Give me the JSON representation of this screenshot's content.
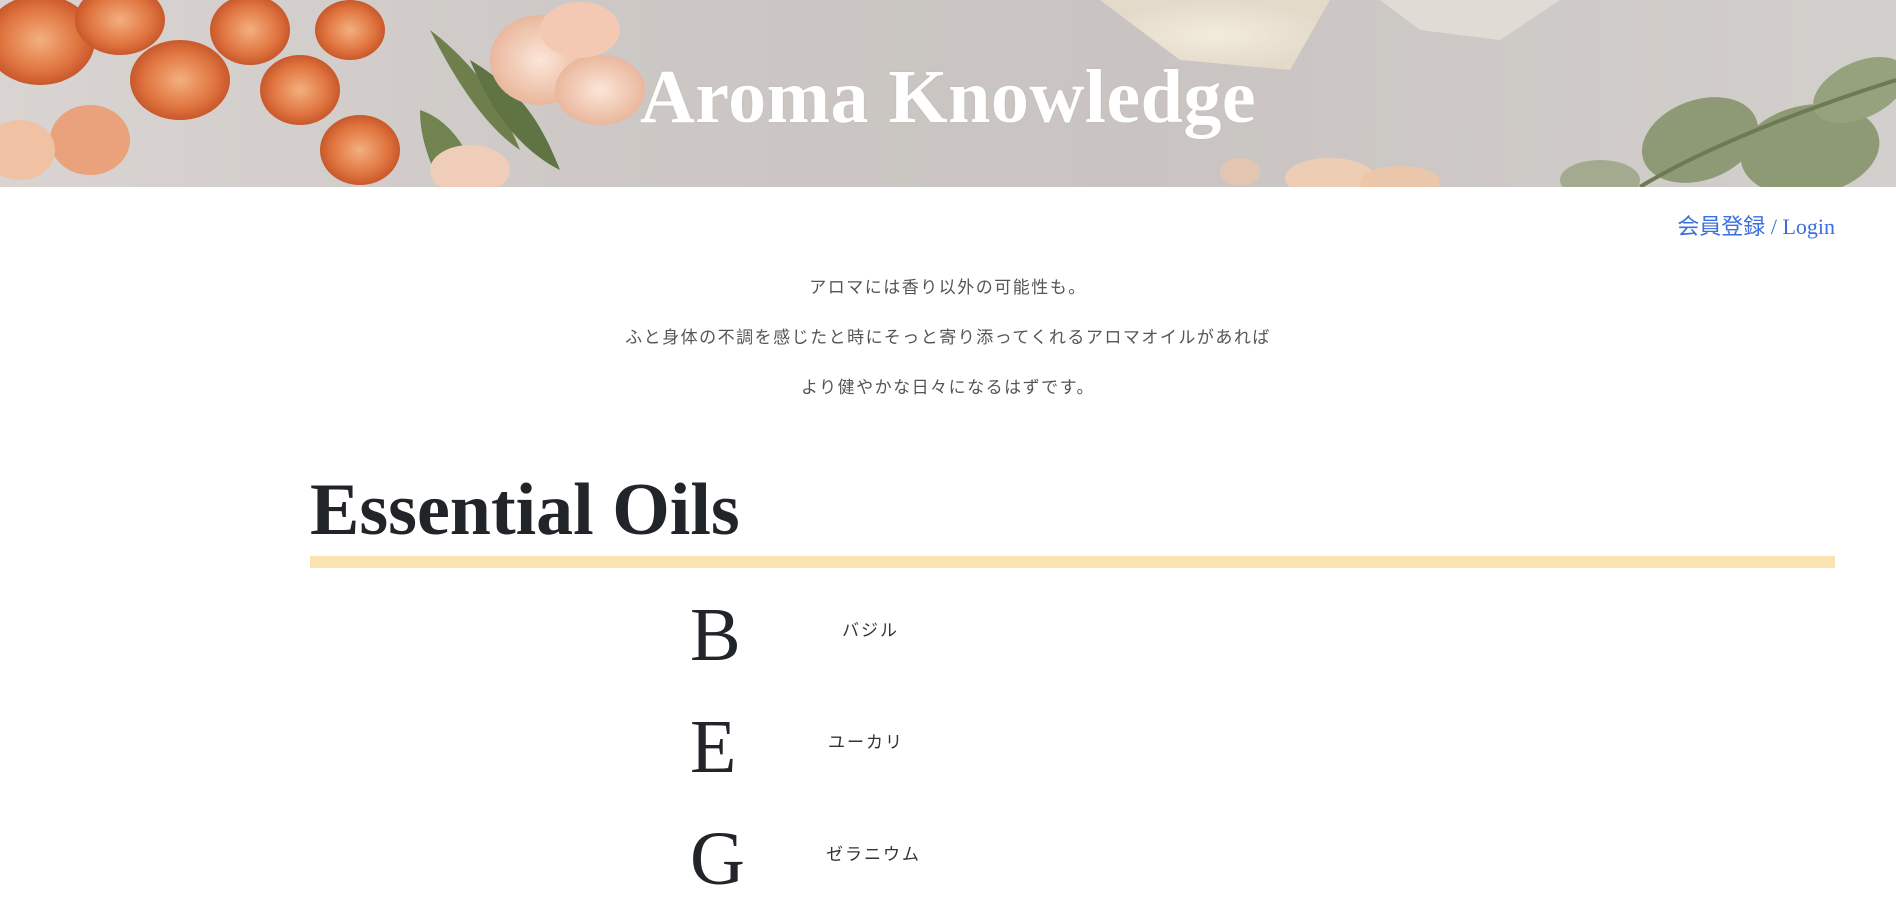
{
  "hero": {
    "title": "Aroma Knowledge"
  },
  "auth": {
    "register_label": "会員登録",
    "separator": "/",
    "login_label": "Login",
    "link_color": "#3b6fde"
  },
  "intro": {
    "lines": [
      "アロマには香り以外の可能性も。",
      "ふと身体の不調を感じたと時にそっと寄り添ってくれるアロマオイルがあれば",
      "より健やかな日々になるはずです。"
    ]
  },
  "section": {
    "title": "Essential Oils",
    "rule_color": "#fbe3b1"
  },
  "oils": [
    {
      "letter": "B",
      "name": "バジル"
    },
    {
      "letter": "E",
      "name": "ユーカリ"
    },
    {
      "letter": "G",
      "name": "ゼラニウム"
    }
  ]
}
